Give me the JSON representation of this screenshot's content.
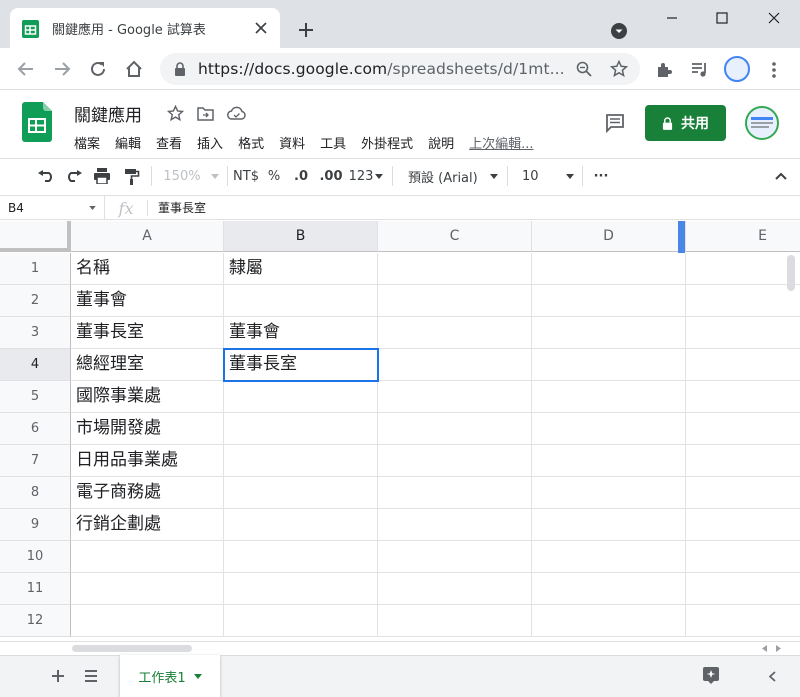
{
  "browser": {
    "tab_title": "關鍵應用 - Google 試算表",
    "url_host": "https://docs.google.com",
    "url_path": "/spreadsheets/d/1mt..."
  },
  "doc": {
    "title": "關鍵應用",
    "menus": [
      "檔案",
      "編輯",
      "查看",
      "插入",
      "格式",
      "資料",
      "工具",
      "外掛程式",
      "說明"
    ],
    "last_edit": "上次編輯...",
    "share_label": "共用"
  },
  "toolbar": {
    "zoom": "150%",
    "currency": "NT$",
    "percent": "%",
    "dec_less": ".0",
    "dec_more": ".00",
    "more_formats": "123",
    "font": "預設 (Arial)",
    "font_size": "10",
    "more": "···"
  },
  "formula_bar": {
    "cell_ref": "B4",
    "fx": "fx",
    "content": "董事長室"
  },
  "grid": {
    "columns": [
      "A",
      "B",
      "C",
      "D",
      "E"
    ],
    "rows": [
      "1",
      "2",
      "3",
      "4",
      "5",
      "6",
      "7",
      "8",
      "9",
      "10",
      "11",
      "12"
    ],
    "col_a": [
      "名稱",
      "董事會",
      "董事長室",
      "總經理室",
      "國際事業處",
      "市場開發處",
      "日用品事業處",
      "電子商務處",
      "行銷企劃處"
    ],
    "col_b": [
      "隸屬",
      "",
      "董事會",
      "董事長室"
    ],
    "selected_cell": "B4"
  },
  "sheets": {
    "tab": "工作表1"
  },
  "colors": {
    "accent_green": "#188038",
    "selection_blue": "#1a73e8"
  }
}
